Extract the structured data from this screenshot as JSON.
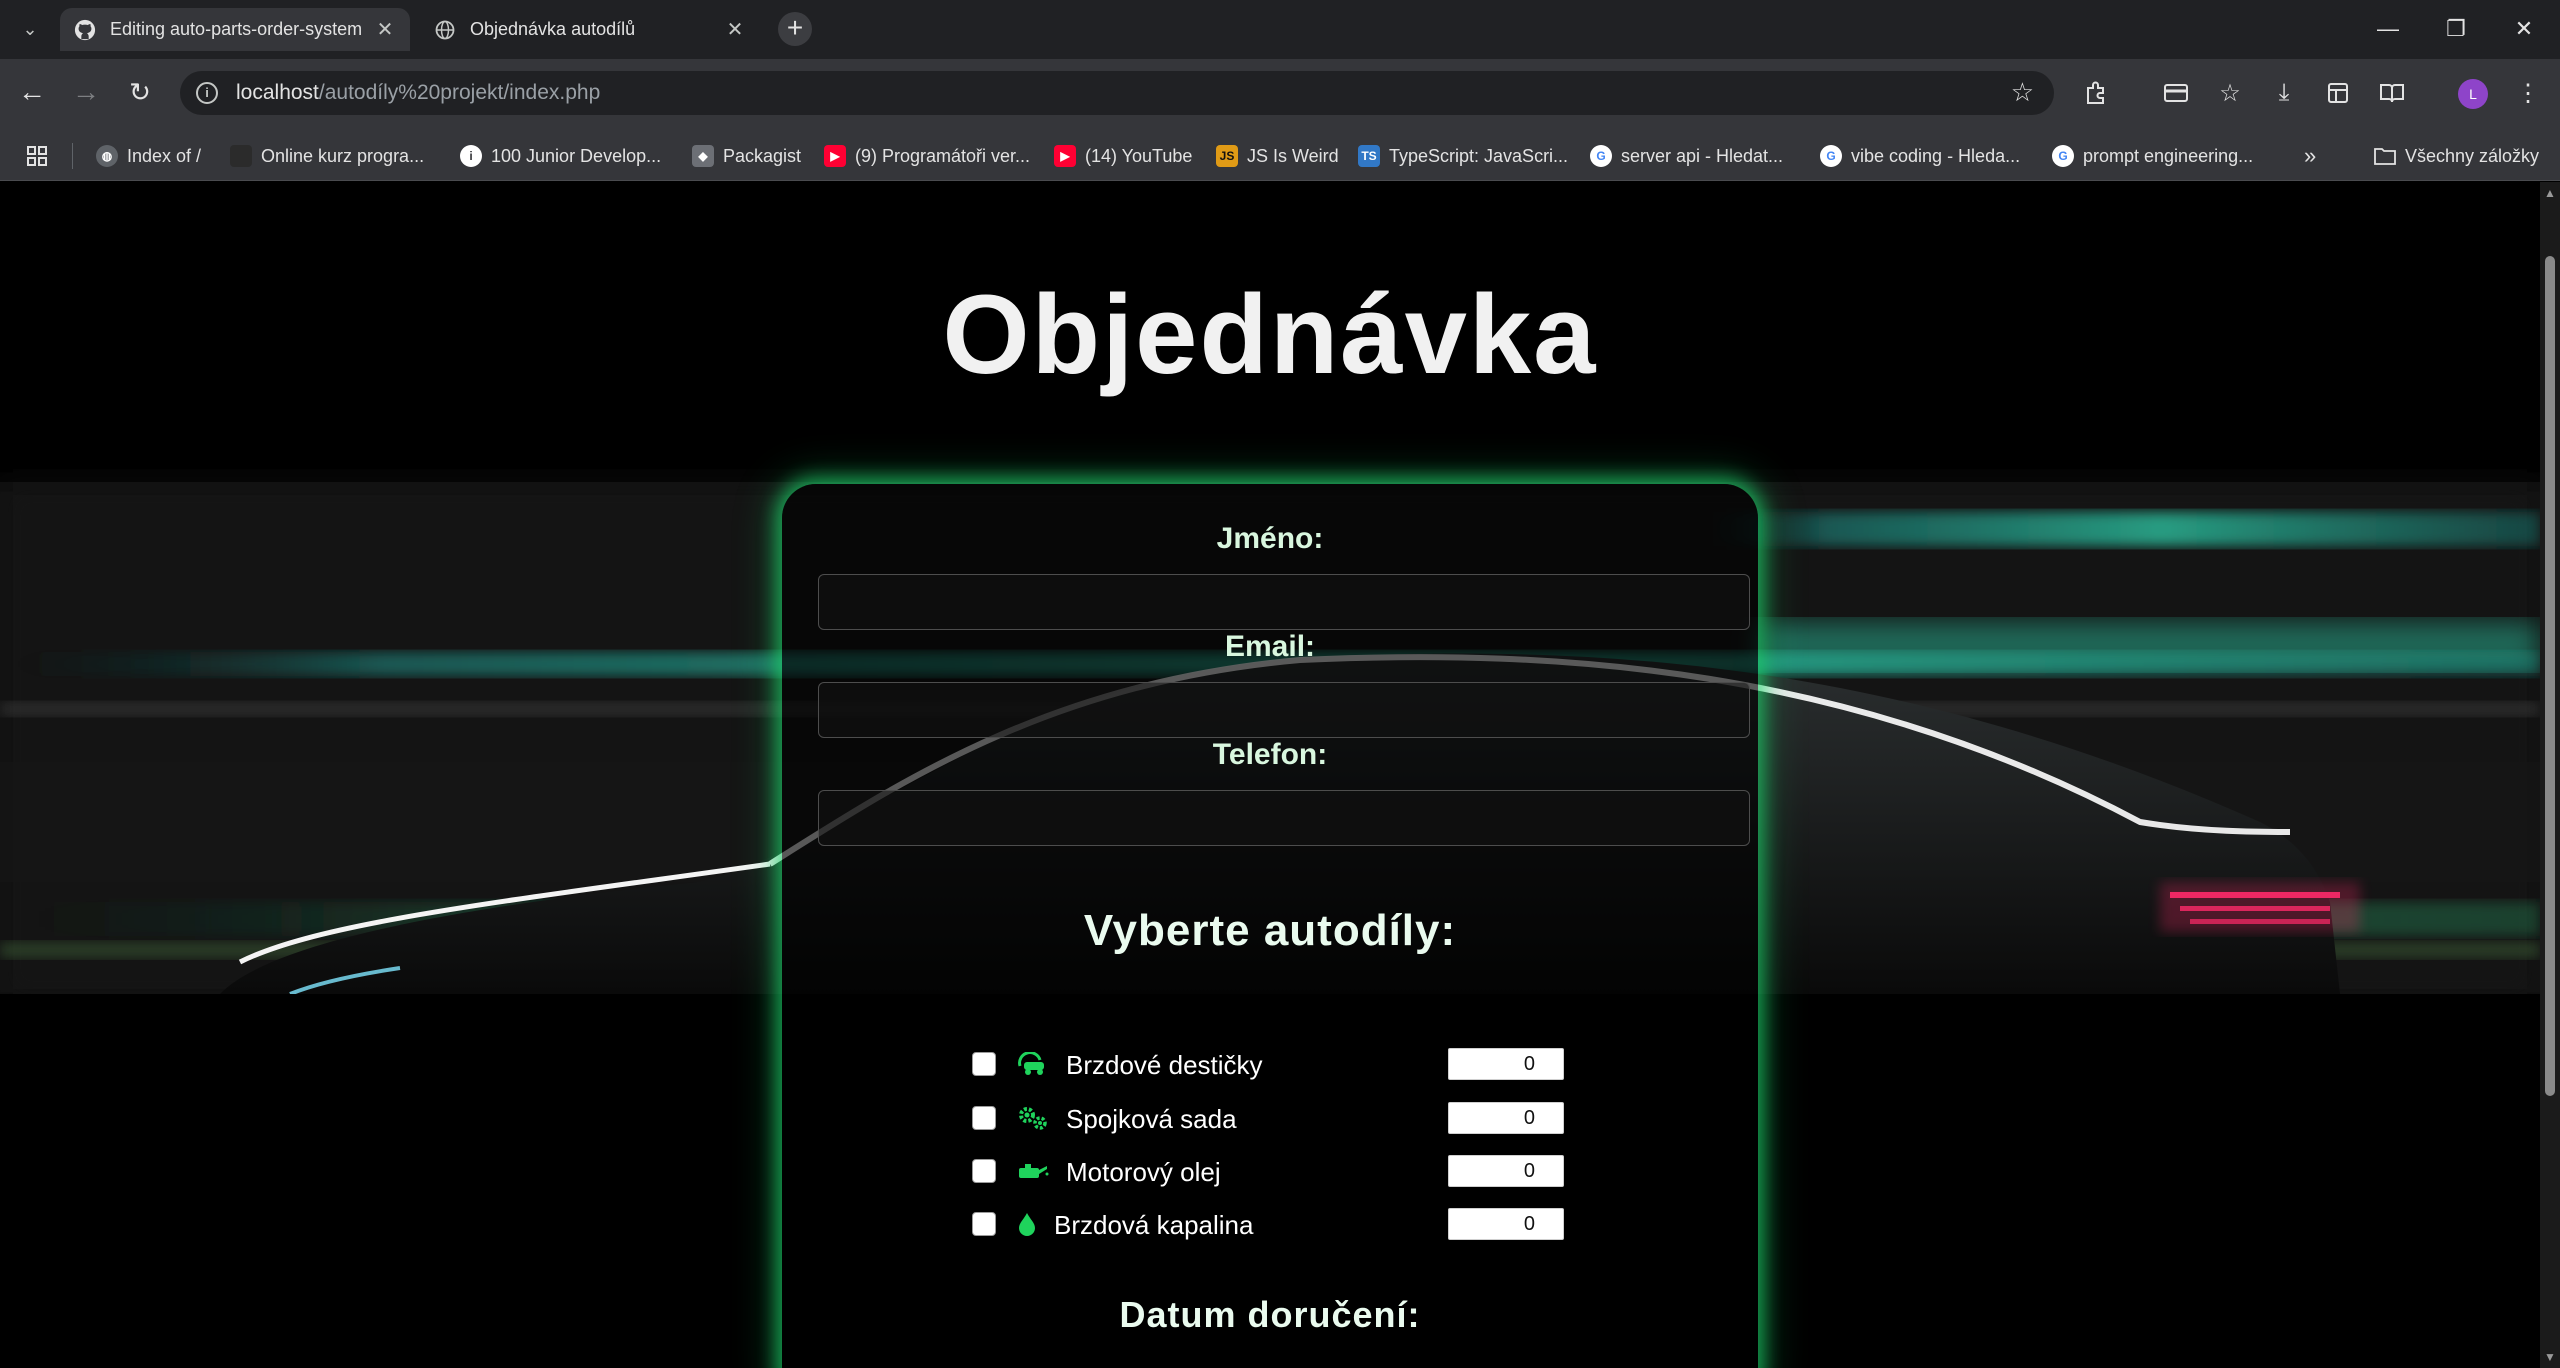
{
  "browser": {
    "tabs": [
      {
        "title": "Editing auto-parts-order-system",
        "icon": "github-icon",
        "active": true
      },
      {
        "title": "Objednávka autodílů",
        "icon": "globe-icon",
        "active": false
      }
    ],
    "url_host": "localhost",
    "url_path": "/autodíly%20projekt/index.php",
    "bookmarks": [
      {
        "label": "Index of /",
        "icon": "globe-icon"
      },
      {
        "label": "Online kurz progra...",
        "icon": "site-icon"
      },
      {
        "label": "100 Junior Develop...",
        "icon": "info-icon"
      },
      {
        "label": "Packagist",
        "icon": "packagist-icon"
      },
      {
        "label": "(9) Programátoři ver...",
        "icon": "youtube-icon"
      },
      {
        "label": "(14) YouTube",
        "icon": "youtube-icon"
      },
      {
        "label": "JS Is Weird",
        "icon": "js-icon"
      },
      {
        "label": "TypeScript: JavaScri...",
        "icon": "ts-icon"
      },
      {
        "label": "server api - Hledat...",
        "icon": "google-icon"
      },
      {
        "label": "vibe coding - Hleda...",
        "icon": "google-icon"
      },
      {
        "label": "prompt engineering...",
        "icon": "google-icon"
      }
    ],
    "all_bookmarks": "Všechny záložky",
    "profile_initial": "L"
  },
  "page": {
    "title": "Objednávka",
    "form": {
      "name_label": "Jméno:",
      "email_label": "Email:",
      "phone_label": "Telefon:",
      "parts_title": "Vyberte autodíly:",
      "parts": [
        {
          "label": "Brzdové destičky",
          "icon": "brake-pad-icon",
          "quantity": "0",
          "checked": false
        },
        {
          "label": "Spojková sada",
          "icon": "gears-icon",
          "quantity": "0",
          "checked": false
        },
        {
          "label": "Motorový olej",
          "icon": "oil-can-icon",
          "quantity": "0",
          "checked": false
        },
        {
          "label": "Brzdová kapalina",
          "icon": "droplet-icon",
          "quantity": "0",
          "checked": false
        }
      ],
      "delivery_title": "Datum doručení:"
    },
    "colors": {
      "accent_green": "#1fd35c",
      "glow": "#1edc6e",
      "light_streak": "#2fd6b0",
      "tail_light": "#ff2a6a"
    }
  }
}
